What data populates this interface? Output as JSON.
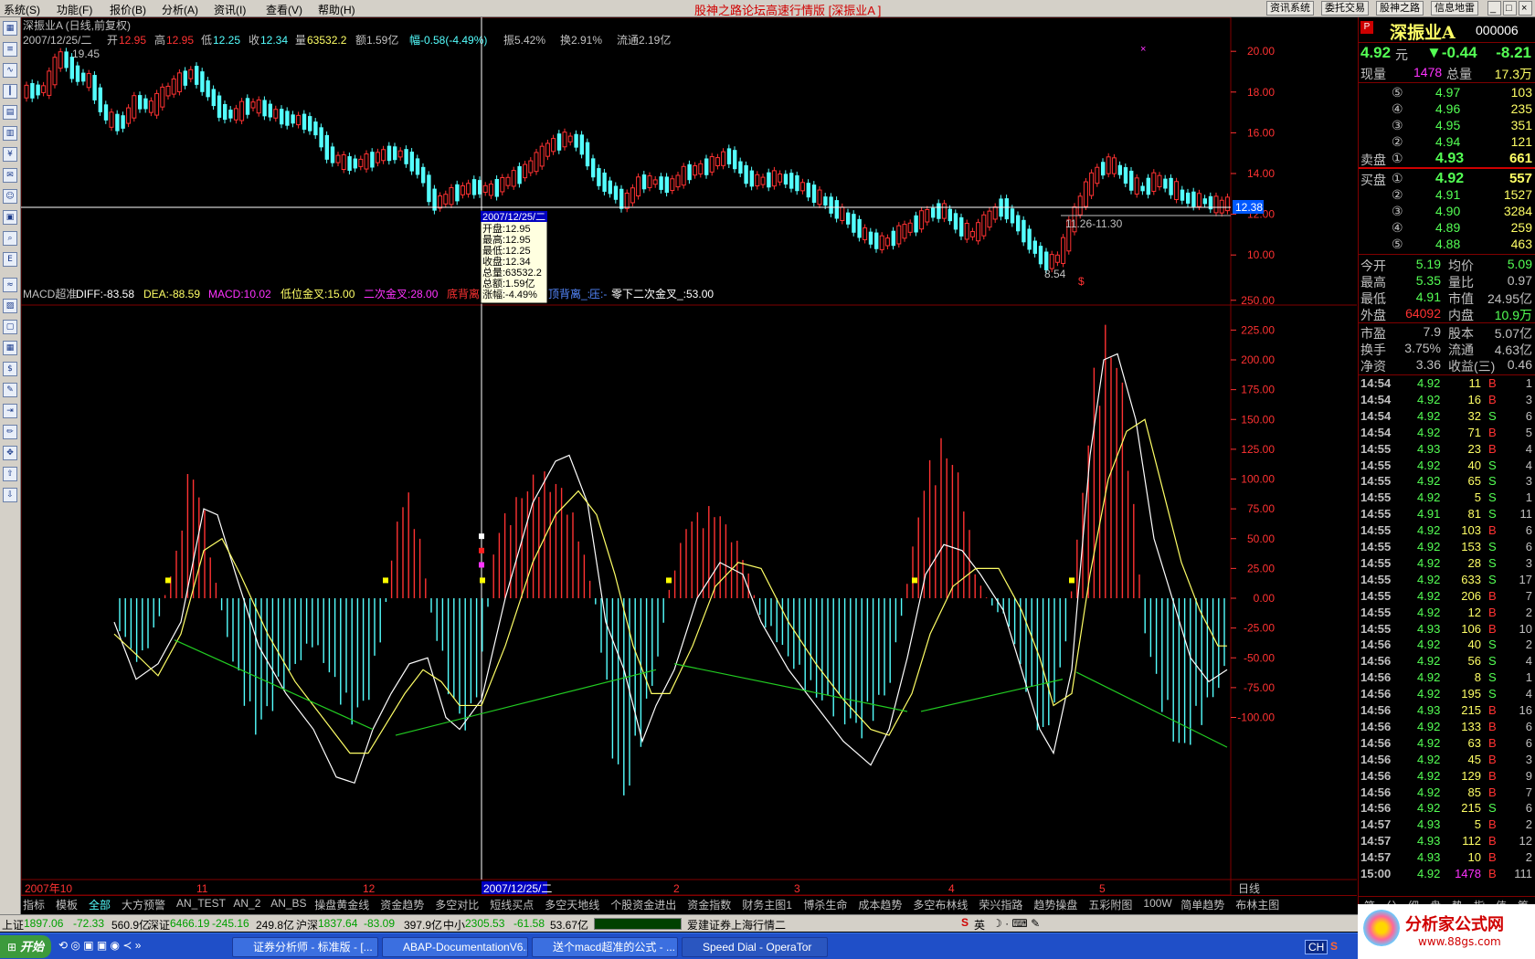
{
  "menu": {
    "items": [
      "系统(S)",
      "功能(F)",
      "报价(B)",
      "分析(A)",
      "资讯(I)",
      "查看(V)",
      "帮助(H)"
    ],
    "title": "股神之路论坛高速行情版 [深振业A ]",
    "right_buttons": [
      "资讯系统",
      "委托交易",
      "股神之路",
      "信息地雷"
    ]
  },
  "stock": {
    "title": "深振业A (日线,前复权)",
    "bar_info": {
      "date": "2007/12/25/二",
      "open_label": "开",
      "open": "12.95",
      "high_label": "高",
      "high": "12.95",
      "low_label": "低",
      "low": "12.25",
      "close_label": "收",
      "close": "12.34",
      "vol_label": "量",
      "vol": "63532.2",
      "amt": "额1.59亿",
      "chg": "幅-0.58(-4.49%)",
      "amp": "振5.42%",
      "turn": "换2.91%",
      "float": "流通2.19亿"
    },
    "price_axis": [
      "20.00",
      "18.00",
      "16.00",
      "14.00",
      "12.00",
      "10.00"
    ],
    "price_tag": "12.38",
    "annotations": {
      "high": "19.45",
      "low": "8.54",
      "range": "11.26-11.30"
    },
    "tooltip": [
      "2007/12/25/二",
      "开盘:12.95",
      "最高:12.95",
      "最低:12.25",
      "收盘:12.34",
      "总量:63532.2",
      "总额:1.59亿",
      "涨幅:-4.49%"
    ],
    "dollar": "$"
  },
  "macd": {
    "name": "MACD超准",
    "diff": "DIFF:-83.58",
    "dea": "DEA:-88.59",
    "macd": "MACD:10.02",
    "low_gold": "低位金叉:15.00",
    "second_gold": "二次金叉:28.00",
    "bottom": "底背离",
    "top_div": "顶背离_:-",
    "pressure": "压:-",
    "zero_below": "零下二次金叉_:53.00",
    "axis": [
      "250.00",
      "225.00",
      "200.00",
      "175.00",
      "150.00",
      "125.00",
      "100.00",
      "75.00",
      "50.00",
      "25.00",
      "0.00",
      "-25.00",
      "-50.00",
      "-75.00",
      "-100.00"
    ]
  },
  "time_axis": {
    "labels": [
      "2007年10",
      "11",
      "12",
      "2007/12/25/二",
      "2",
      "3",
      "4",
      "5"
    ],
    "period": "日线"
  },
  "bottom_tabs": [
    "指标",
    "模板",
    "全部",
    "大方预警",
    "AN_TEST",
    "AN_2",
    "AN_BS",
    "操盘黄金线",
    "资金趋势",
    "多空对比",
    "短线买点",
    "多空天地线",
    "个股资金进出",
    "资金指数",
    "财务主图1",
    "博杀生命",
    "成本趋势",
    "多空布林线",
    "荣兴指路",
    "趋势操盘",
    "五彩附图",
    "100W",
    "简单趋势",
    "布林主图"
  ],
  "quote": {
    "name": "深振业A",
    "code": "000006",
    "price": "4.92",
    "price_unit": "元",
    "change": "▼-0.44",
    "pct": "-8.21",
    "now_vol_label": "现量",
    "now_vol": "1478",
    "total_vol_label": "总量",
    "total_vol": "17.3万",
    "sells": [
      {
        "lv": "⑤",
        "p": "4.97",
        "v": "103"
      },
      {
        "lv": "④",
        "p": "4.96",
        "v": "235"
      },
      {
        "lv": "③",
        "p": "4.95",
        "v": "351"
      },
      {
        "lv": "②",
        "p": "4.94",
        "v": "121"
      },
      {
        "lv": "①",
        "p": "4.93",
        "v": "661"
      }
    ],
    "sell_label": "卖盘",
    "buy_label": "买盘",
    "buys": [
      {
        "lv": "①",
        "p": "4.92",
        "v": "557"
      },
      {
        "lv": "②",
        "p": "4.91",
        "v": "1527"
      },
      {
        "lv": "③",
        "p": "4.90",
        "v": "3284"
      },
      {
        "lv": "④",
        "p": "4.89",
        "v": "259"
      },
      {
        "lv": "⑤",
        "p": "4.88",
        "v": "463"
      }
    ],
    "stats": [
      {
        "l1": "今开",
        "v1": "5.19",
        "l2": "均价",
        "v2": "5.09"
      },
      {
        "l1": "最高",
        "v1": "5.35",
        "l2": "量比",
        "v2": "0.97"
      },
      {
        "l1": "最低",
        "v1": "4.91",
        "l2": "市值",
        "v2": "24.95亿"
      },
      {
        "l1": "外盘",
        "v1": "64092",
        "l2": "内盘",
        "v2": "10.9万"
      },
      {
        "l1": "市盈",
        "v1": "7.9",
        "l2": "股本",
        "v2": "5.07亿"
      },
      {
        "l1": "换手",
        "v1": "3.75%",
        "l2": "流通",
        "v2": "4.63亿"
      },
      {
        "l1": "净资",
        "v1": "3.36",
        "l2": "收益(三)",
        "v2": "0.46"
      }
    ],
    "ticks": [
      [
        "14:54",
        "4.92",
        "11",
        "B",
        "1"
      ],
      [
        "14:54",
        "4.92",
        "16",
        "B",
        "3"
      ],
      [
        "14:54",
        "4.92",
        "32",
        "S",
        "6"
      ],
      [
        "14:54",
        "4.92",
        "71",
        "B",
        "5"
      ],
      [
        "14:55",
        "4.93",
        "23",
        "B",
        "4"
      ],
      [
        "14:55",
        "4.92",
        "40",
        "S",
        "4"
      ],
      [
        "14:55",
        "4.92",
        "65",
        "S",
        "3"
      ],
      [
        "14:55",
        "4.92",
        "5",
        "S",
        "1"
      ],
      [
        "14:55",
        "4.91",
        "81",
        "S",
        "11"
      ],
      [
        "14:55",
        "4.92",
        "103",
        "B",
        "6"
      ],
      [
        "14:55",
        "4.92",
        "153",
        "S",
        "6"
      ],
      [
        "14:55",
        "4.92",
        "28",
        "S",
        "3"
      ],
      [
        "14:55",
        "4.92",
        "633",
        "S",
        "17"
      ],
      [
        "14:55",
        "4.92",
        "206",
        "B",
        "7"
      ],
      [
        "14:55",
        "4.92",
        "12",
        "B",
        "2"
      ],
      [
        "14:55",
        "4.93",
        "106",
        "B",
        "10"
      ],
      [
        "14:56",
        "4.92",
        "40",
        "S",
        "2"
      ],
      [
        "14:56",
        "4.92",
        "56",
        "S",
        "4"
      ],
      [
        "14:56",
        "4.92",
        "8",
        "S",
        "1"
      ],
      [
        "14:56",
        "4.92",
        "195",
        "S",
        "4"
      ],
      [
        "14:56",
        "4.93",
        "215",
        "B",
        "16"
      ],
      [
        "14:56",
        "4.92",
        "133",
        "B",
        "6"
      ],
      [
        "14:56",
        "4.92",
        "63",
        "B",
        "6"
      ],
      [
        "14:56",
        "4.92",
        "45",
        "B",
        "3"
      ],
      [
        "14:56",
        "4.92",
        "129",
        "B",
        "9"
      ],
      [
        "14:56",
        "4.92",
        "85",
        "B",
        "7"
      ],
      [
        "14:56",
        "4.92",
        "215",
        "S",
        "6"
      ],
      [
        "14:57",
        "4.93",
        "5",
        "B",
        "2"
      ],
      [
        "14:57",
        "4.93",
        "112",
        "B",
        "12"
      ],
      [
        "14:57",
        "4.93",
        "10",
        "B",
        "2"
      ],
      [
        "15:00",
        "4.92",
        "1478",
        "B",
        "111"
      ]
    ],
    "bottom_tabs": [
      "笔",
      "分",
      "细",
      "盘",
      "势",
      "指",
      "值",
      "筹"
    ]
  },
  "status": {
    "sh_label": "上证",
    "sh": "1897.06",
    "sh_chg": "-72.33",
    "sh_amt": "560.9亿",
    "sz_label": "深证",
    "sz": "6466.19",
    "sz_chg": "-245.16",
    "sz_amt": "249.8亿",
    "hs_label": "沪深",
    "hs": "1837.64",
    "hs_chg": "-83.09",
    "hs_amt": "397.9亿",
    "zx_label": "中小",
    "zx": "2305.53",
    "zx_chg": "-61.58",
    "zx_amt": "53.67亿",
    "server": "爱建证券上海行情二",
    "ime": "英"
  },
  "logo": {
    "text": "分析家公式网",
    "url": "www.88gs.com"
  },
  "taskbar": {
    "start": "开始",
    "windows": [
      "证券分析师 - 标准版 - [...",
      "ABAP-DocumentationV6....",
      "送个macd超准的公式 - ...",
      "Speed Dial - OperaTor"
    ],
    "tray": "CH"
  },
  "colors": {
    "up": "#ff3232",
    "down": "#54ffff",
    "diff": "#ffffff",
    "dea": "#ffff66",
    "trend": "#22cc22"
  }
}
